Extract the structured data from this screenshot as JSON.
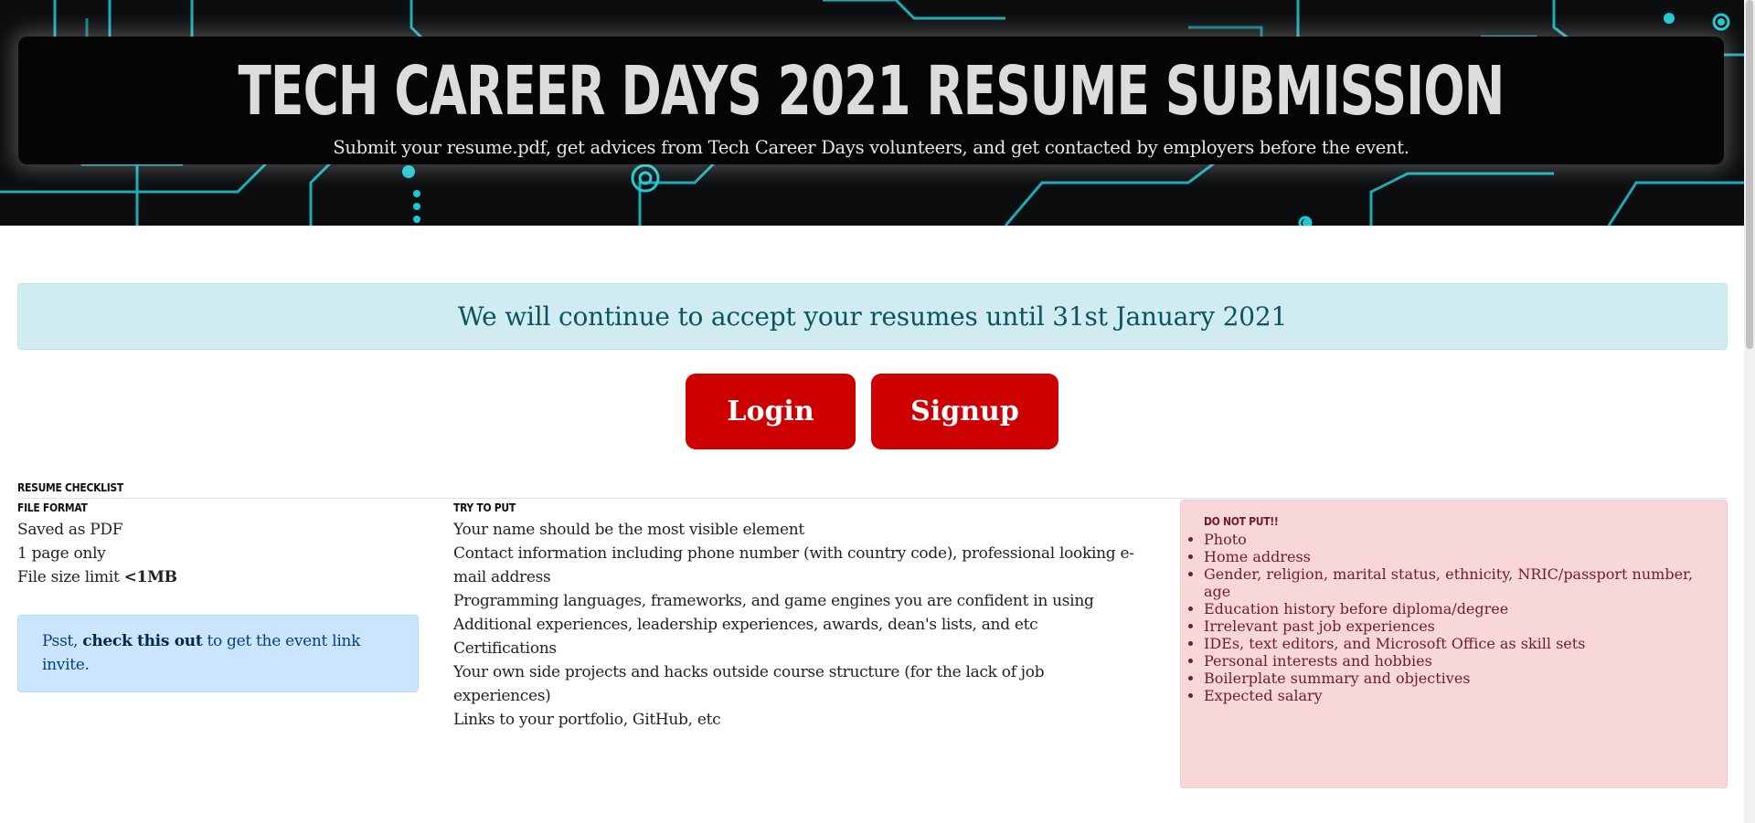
{
  "hero": {
    "title": "TECH CAREER DAYS 2021 RESUME SUBMISSION",
    "subtitle": "Submit your resume.pdf, get advices from Tech Career Days volunteers, and get contacted by employers before the event."
  },
  "notice": {
    "text": "We will continue to accept your resumes until 31st January 2021"
  },
  "auth": {
    "login_label": "Login",
    "signup_label": "Signup"
  },
  "checklist": {
    "title": "Resume Checklist",
    "file_format": {
      "heading": "File Format",
      "item_pdf": "Saved as PDF",
      "item_pages": "1 page only",
      "item_size_prefix": "File size limit ",
      "item_size_value": "<1MB"
    },
    "psst": {
      "prefix": "Psst, ",
      "link": "check this out",
      "suffix": " to get the event link invite."
    },
    "try_to_put": {
      "heading": "Try to Put",
      "items": [
        "Your name should be the most visible element",
        "Contact information including phone number (with country code), professional looking e-mail address",
        "Programming languages, frameworks, and game engines you are confident in using",
        "Additional experiences, leadership experiences, awards, dean's lists, and etc",
        "Certifications",
        "Your own side projects and hacks outside course structure (for the lack of job experiences)",
        "Links to your portfolio, GitHub, etc"
      ]
    },
    "do_not_put": {
      "heading": "Do Not Put!!",
      "items": [
        "Photo",
        "Home address",
        "Gender, religion, marital status, ethnicity, NRIC/passport number, age",
        "Education history before diploma/degree",
        "Irrelevant past job experiences",
        "IDEs, text editors, and Microsoft Office as skill sets",
        "Personal interests and hobbies",
        "Boilerplate summary and objectives",
        "Expected salary"
      ]
    }
  },
  "colors": {
    "accent_red": "#cc0000",
    "circuit_cyan": "#1ec8d2",
    "notice_bg": "#d1ecf1",
    "info_bg": "#cce5ff",
    "danger_bg": "#f8d7da"
  }
}
